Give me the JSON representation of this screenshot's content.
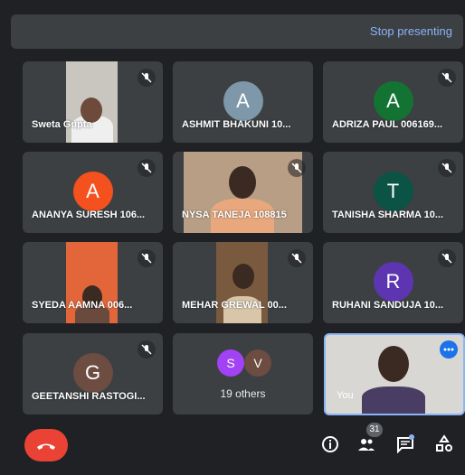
{
  "topbar": {
    "stop_presenting": "Stop presenting"
  },
  "tiles": [
    {
      "name": "Sweta Gupta"
    },
    {
      "name": "ASHMIT BHAKUNI 10...",
      "initial": "A",
      "color": "#7e97a9"
    },
    {
      "name": "ADRIZA PAUL 006169...",
      "initial": "A",
      "color": "#137333"
    },
    {
      "name": "ANANYA SURESH 106...",
      "initial": "A",
      "color": "#f4511e"
    },
    {
      "name": "NYSA TANEJA 108815"
    },
    {
      "name": "TANISHA SHARMA 10...",
      "initial": "T",
      "color": "#0b5345"
    },
    {
      "name": "SYEDA AAMNA 006..."
    },
    {
      "name": "MEHAR GREWAL 00..."
    },
    {
      "name": "RUHANI SANDUJA 10...",
      "initial": "R",
      "color": "#5e35b1"
    },
    {
      "name": "GEETANSHI RASTOGI...",
      "initial": "G",
      "color": "#6d4c41"
    }
  ],
  "others": {
    "avatars": [
      {
        "initial": "S",
        "color": "#a142f4"
      },
      {
        "initial": "V",
        "color": "#6d4c41"
      }
    ],
    "label": "19 others"
  },
  "self": {
    "label": "You"
  },
  "controls": {
    "people_count": "31"
  },
  "icons": {
    "mic_off": "mic-off-icon",
    "end_call": "phone-hangup-icon",
    "info": "info-icon",
    "people": "people-icon",
    "chat": "chat-icon",
    "activities": "activities-icon",
    "more": "more-icon"
  }
}
